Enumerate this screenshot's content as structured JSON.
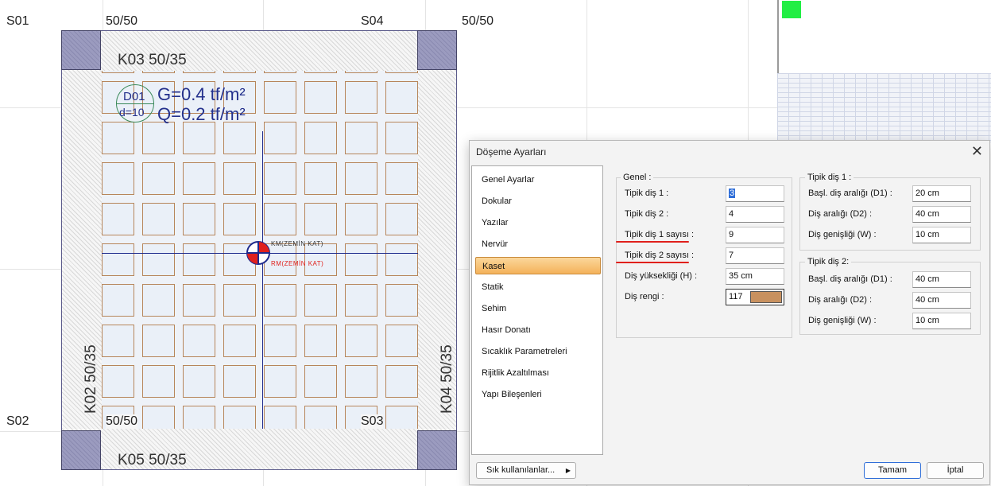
{
  "cad": {
    "axis_labels": {
      "s01": "S01",
      "s02": "S02",
      "s03": "S03",
      "s04": "S04"
    },
    "col_dims": {
      "tl": "50/50",
      "tr": "50/50",
      "bl": "50/50"
    },
    "beams": {
      "k03": "K03 50/35",
      "k05": "K05 50/35",
      "k02": "K02 50/35",
      "k04": "K04 50/35"
    },
    "slab": {
      "name": "D01",
      "thickness": "d=10",
      "load_g": "G=0.4 tf/m²",
      "load_q": "Q=0.2 tf/m²"
    },
    "center_marks": {
      "km": "KM(ZEMİN KAT)",
      "rm": "RM(ZEMİN KAT)"
    },
    "colors": {
      "rib": "#1e2a8c",
      "cell_border": "#b7865b",
      "column": "#9b9bbf"
    }
  },
  "dialog": {
    "title": "Döşeme Ayarları",
    "nav": [
      {
        "label": "Genel Ayarlar"
      },
      {
        "label": "Dokular"
      },
      {
        "label": "Yazılar"
      },
      {
        "label": "Nervür"
      },
      {
        "label": "Kaset",
        "selected": true
      },
      {
        "label": "Statik"
      },
      {
        "label": "Sehim"
      },
      {
        "label": "Hasır Donatı"
      },
      {
        "label": "Sıcaklık Parametreleri"
      },
      {
        "label": "Rijitlik Azaltılması"
      },
      {
        "label": "Yapı Bileşenleri"
      }
    ],
    "genel": {
      "title": "Genel :",
      "tipik1_label": "Tipik diş 1 :",
      "tipik1_value": "3",
      "tipik2_label": "Tipik diş 2 :",
      "tipik2_value": "4",
      "sayisi1_label": "Tipik diş 1 sayısı :",
      "sayisi1_value": "9",
      "sayisi2_label": "Tipik diş 2 sayısı :",
      "sayisi2_value": "7",
      "yukseklik_label": "Diş yüksekliği (H) :",
      "yukseklik_value": "35 cm",
      "renk_label": "Diş rengi :",
      "renk_value": "117",
      "renk_color": "#c8915f"
    },
    "dis1": {
      "title": "Tipik diş 1 :",
      "d1_label": "Başl. diş aralığı (D1) :",
      "d1_value": "20 cm",
      "d2_label": "Diş aralığı (D2) :",
      "d2_value": "40 cm",
      "w_label": "Diş genişliği (W) :",
      "w_value": "10 cm"
    },
    "dis2": {
      "title": "Tipik diş 2:",
      "d1_label": "Başl. diş aralığı (D1) :",
      "d1_value": "40 cm",
      "d2_label": "Diş aralığı (D2) :",
      "d2_value": "40 cm",
      "w_label": "Diş genişliği (W) :",
      "w_value": "10 cm"
    },
    "buttons": {
      "frequent": "Sık kullanılanlar...",
      "ok": "Tamam",
      "cancel": "İptal"
    }
  }
}
